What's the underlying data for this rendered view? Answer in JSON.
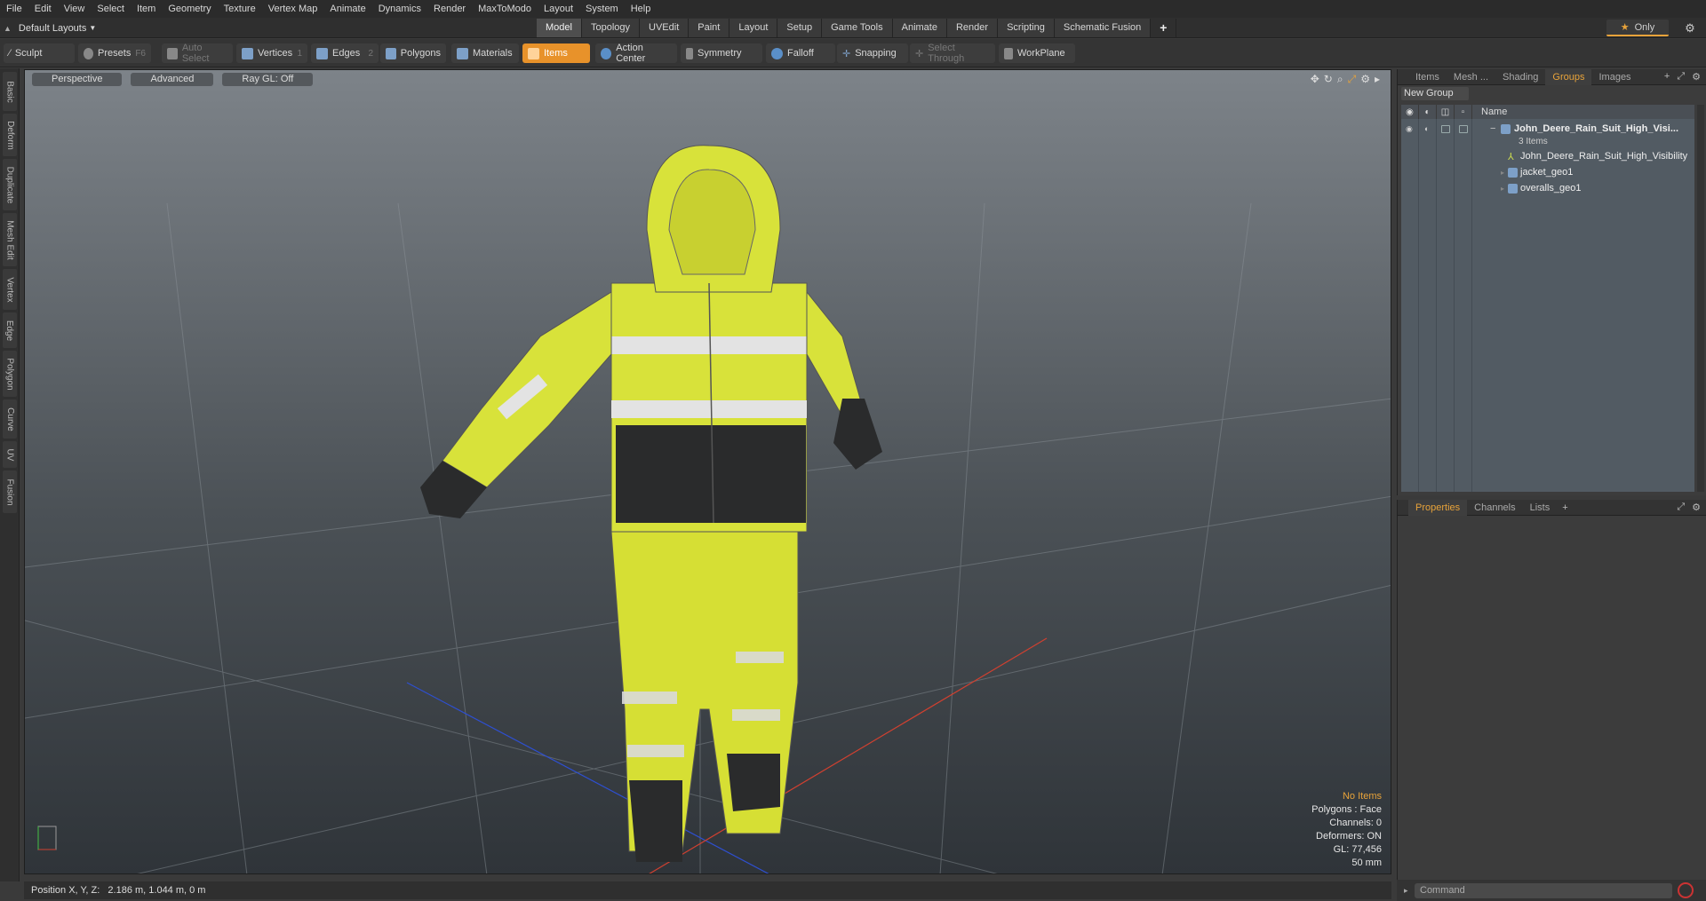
{
  "menu": [
    "File",
    "Edit",
    "View",
    "Select",
    "Item",
    "Geometry",
    "Texture",
    "Vertex Map",
    "Animate",
    "Dynamics",
    "Render",
    "MaxToModo",
    "Layout",
    "System",
    "Help"
  ],
  "layouts_label": "Default Layouts",
  "top_tabs": [
    "Model",
    "Topology",
    "UVEdit",
    "Paint",
    "Layout",
    "Setup",
    "Game Tools",
    "Animate",
    "Render",
    "Scripting",
    "Schematic Fusion"
  ],
  "active_tab": "Model",
  "only_label": "Only",
  "toolbar": {
    "sculpt": "Sculpt",
    "presets": "Presets",
    "presets_key": "F6",
    "auto_select": "Auto Select",
    "vertices": "Vertices",
    "vertices_key": "1",
    "edges": "Edges",
    "edges_key": "2",
    "polygons": "Polygons",
    "materials": "Materials",
    "items": "Items",
    "action_center": "Action Center",
    "symmetry": "Symmetry",
    "falloff": "Falloff",
    "snapping": "Snapping",
    "select_through": "Select Through",
    "workplane": "WorkPlane"
  },
  "side_tabs": [
    "Basic",
    "Deform",
    "Duplicate",
    "Mesh Edit",
    "Vertex",
    "Edge",
    "Polygon",
    "Curve",
    "UV",
    "Fusion"
  ],
  "viewport": {
    "view_mode": "Perspective",
    "shading": "Advanced",
    "raygl": "Ray GL: Off",
    "info": [
      "No Items",
      "Polygons : Face",
      "Channels: 0",
      "Deformers: ON",
      "GL: 77,456",
      "50 mm"
    ]
  },
  "status": "Position X, Y, Z:   2.186 m, 1.044 m, 0 m",
  "right_tabs": [
    "Items",
    "Mesh ...",
    "Shading",
    "Groups",
    "Images"
  ],
  "right_active": "Groups",
  "new_group": "New Group",
  "col_name": "Name",
  "tree": {
    "group": "John_Deere_Rain_Suit_High_Visi...",
    "count": "3 Items",
    "children": [
      "John_Deere_Rain_Suit_High_Visibility",
      "jacket_geo1",
      "overalls_geo1"
    ]
  },
  "bottom_tabs": [
    "Properties",
    "Channels",
    "Lists"
  ],
  "bottom_active": "Properties",
  "command_placeholder": "Command",
  "colors": {
    "accent": "#e8922a",
    "jacket": "#d8e23a",
    "dark": "#2a2b2c"
  }
}
